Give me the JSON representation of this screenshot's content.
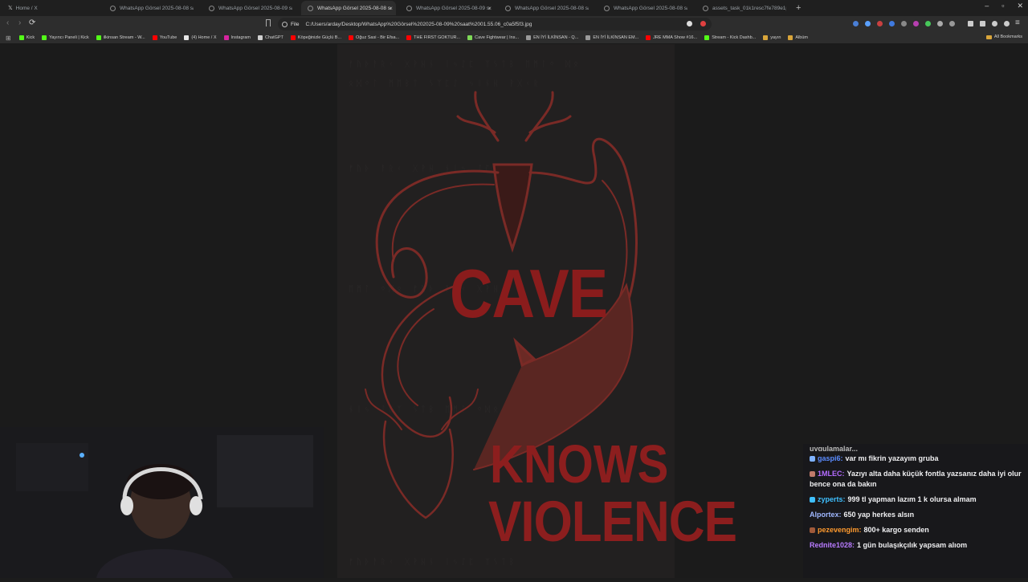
{
  "tabs": [
    {
      "title": "Home / X",
      "active": false,
      "icon": "x-logo-icon"
    },
    {
      "title": "WhatsApp Görsel 2025-08-08 saat 1",
      "active": false,
      "icon": "globe-icon"
    },
    {
      "title": "WhatsApp Görsel 2025-08-09 saat 0",
      "active": false,
      "icon": "globe-icon"
    },
    {
      "title": "WhatsApp Görsel 2025-08-08 sa",
      "active": true,
      "icon": "globe-icon"
    },
    {
      "title": "WhatsApp Görsel 2025-08-09 sa",
      "active": false,
      "icon": "globe-icon"
    },
    {
      "title": "WhatsApp Görsel 2025-08-08 saat 2",
      "active": false,
      "icon": "globe-icon"
    },
    {
      "title": "WhatsApp Görsel 2025-08-08 saat 2",
      "active": false,
      "icon": "globe-icon"
    },
    {
      "title": "assets_task_01k1resc7fe789e1pxh",
      "active": false,
      "icon": "globe-icon"
    }
  ],
  "toolbar": {
    "scheme": "File",
    "url": "C:/Users/arday/Desktop/WhatsApp%20Görsel%202025-08-09%20saat%2001.55.06_c0a5f5f3.jpg"
  },
  "bookmarks": [
    {
      "label": "Kick",
      "color": "#53fc18"
    },
    {
      "label": "Yayıncı Paneli | Kick",
      "color": "#53fc18"
    },
    {
      "label": "ilkinsan Stream - W...",
      "color": "#53fc18"
    },
    {
      "label": "YouTube",
      "color": "#ff0000"
    },
    {
      "label": "(4) Home / X",
      "color": "#e7e7e7"
    },
    {
      "label": "Instagram",
      "color": "#d6249f"
    },
    {
      "label": "ChatGPT",
      "color": "#d0d0d0"
    },
    {
      "label": "Köpeğinizle Güçlü B...",
      "color": "#ff0000"
    },
    {
      "label": "Oğuz Sasi - Bir Efsa...",
      "color": "#ff0000"
    },
    {
      "label": "THE FIRST GOKTUR...",
      "color": "#ff0000"
    },
    {
      "label": "Cave Fightwear | Ins...",
      "color": "#7ed957"
    },
    {
      "label": "EN İYİ İLKİNSAN - Q...",
      "color": "#9a9a9a"
    },
    {
      "label": "EN İYİ İLKİNSAN EM...",
      "color": "#9a9a9a"
    },
    {
      "label": "JRE MMA Show #16...",
      "color": "#ff0000"
    },
    {
      "label": "Stream - Kick Dashb...",
      "color": "#53fc18"
    },
    {
      "label": "yayın",
      "color": "#d9a53a"
    },
    {
      "label": "Albüm",
      "color": "#d9a53a"
    }
  ],
  "all_bookmarks": "All Bookmarks",
  "poster": {
    "word1": "CAVE",
    "word2": "KNOWS",
    "word3": "VIOLENCE"
  },
  "chat": {
    "partial": "uygulamalar...",
    "messages": [
      {
        "user": "gaspi6:",
        "text": "var mı fikrin yazayım gruba",
        "color": "#5b8cff",
        "badge": "#7fb2ff"
      },
      {
        "user": "1MLEC:",
        "text": "Yazıyı alta daha küçük fontla yazsanız daha iyi olur bence ona da bakın",
        "color": "#b46bff",
        "badge": "#c07a6a"
      },
      {
        "user": "zyperts:",
        "text": "999 tl yapman lazım 1 k olursa almam",
        "color": "#3fc0ff",
        "badge": "#3fc0ff"
      },
      {
        "user": "Alportex:",
        "text": "650 yap herkes alsın",
        "color": "#9fb7ff",
        "badge": ""
      },
      {
        "user": "pezevengim:",
        "text": "800+ kargo senden",
        "color": "#ff9a2e",
        "badge": "#a05a3a"
      },
      {
        "user": "Rednite1028:",
        "text": "1 gün bulaşıkçılık yapsam alıom",
        "color": "#b87bff",
        "badge": ""
      }
    ]
  }
}
